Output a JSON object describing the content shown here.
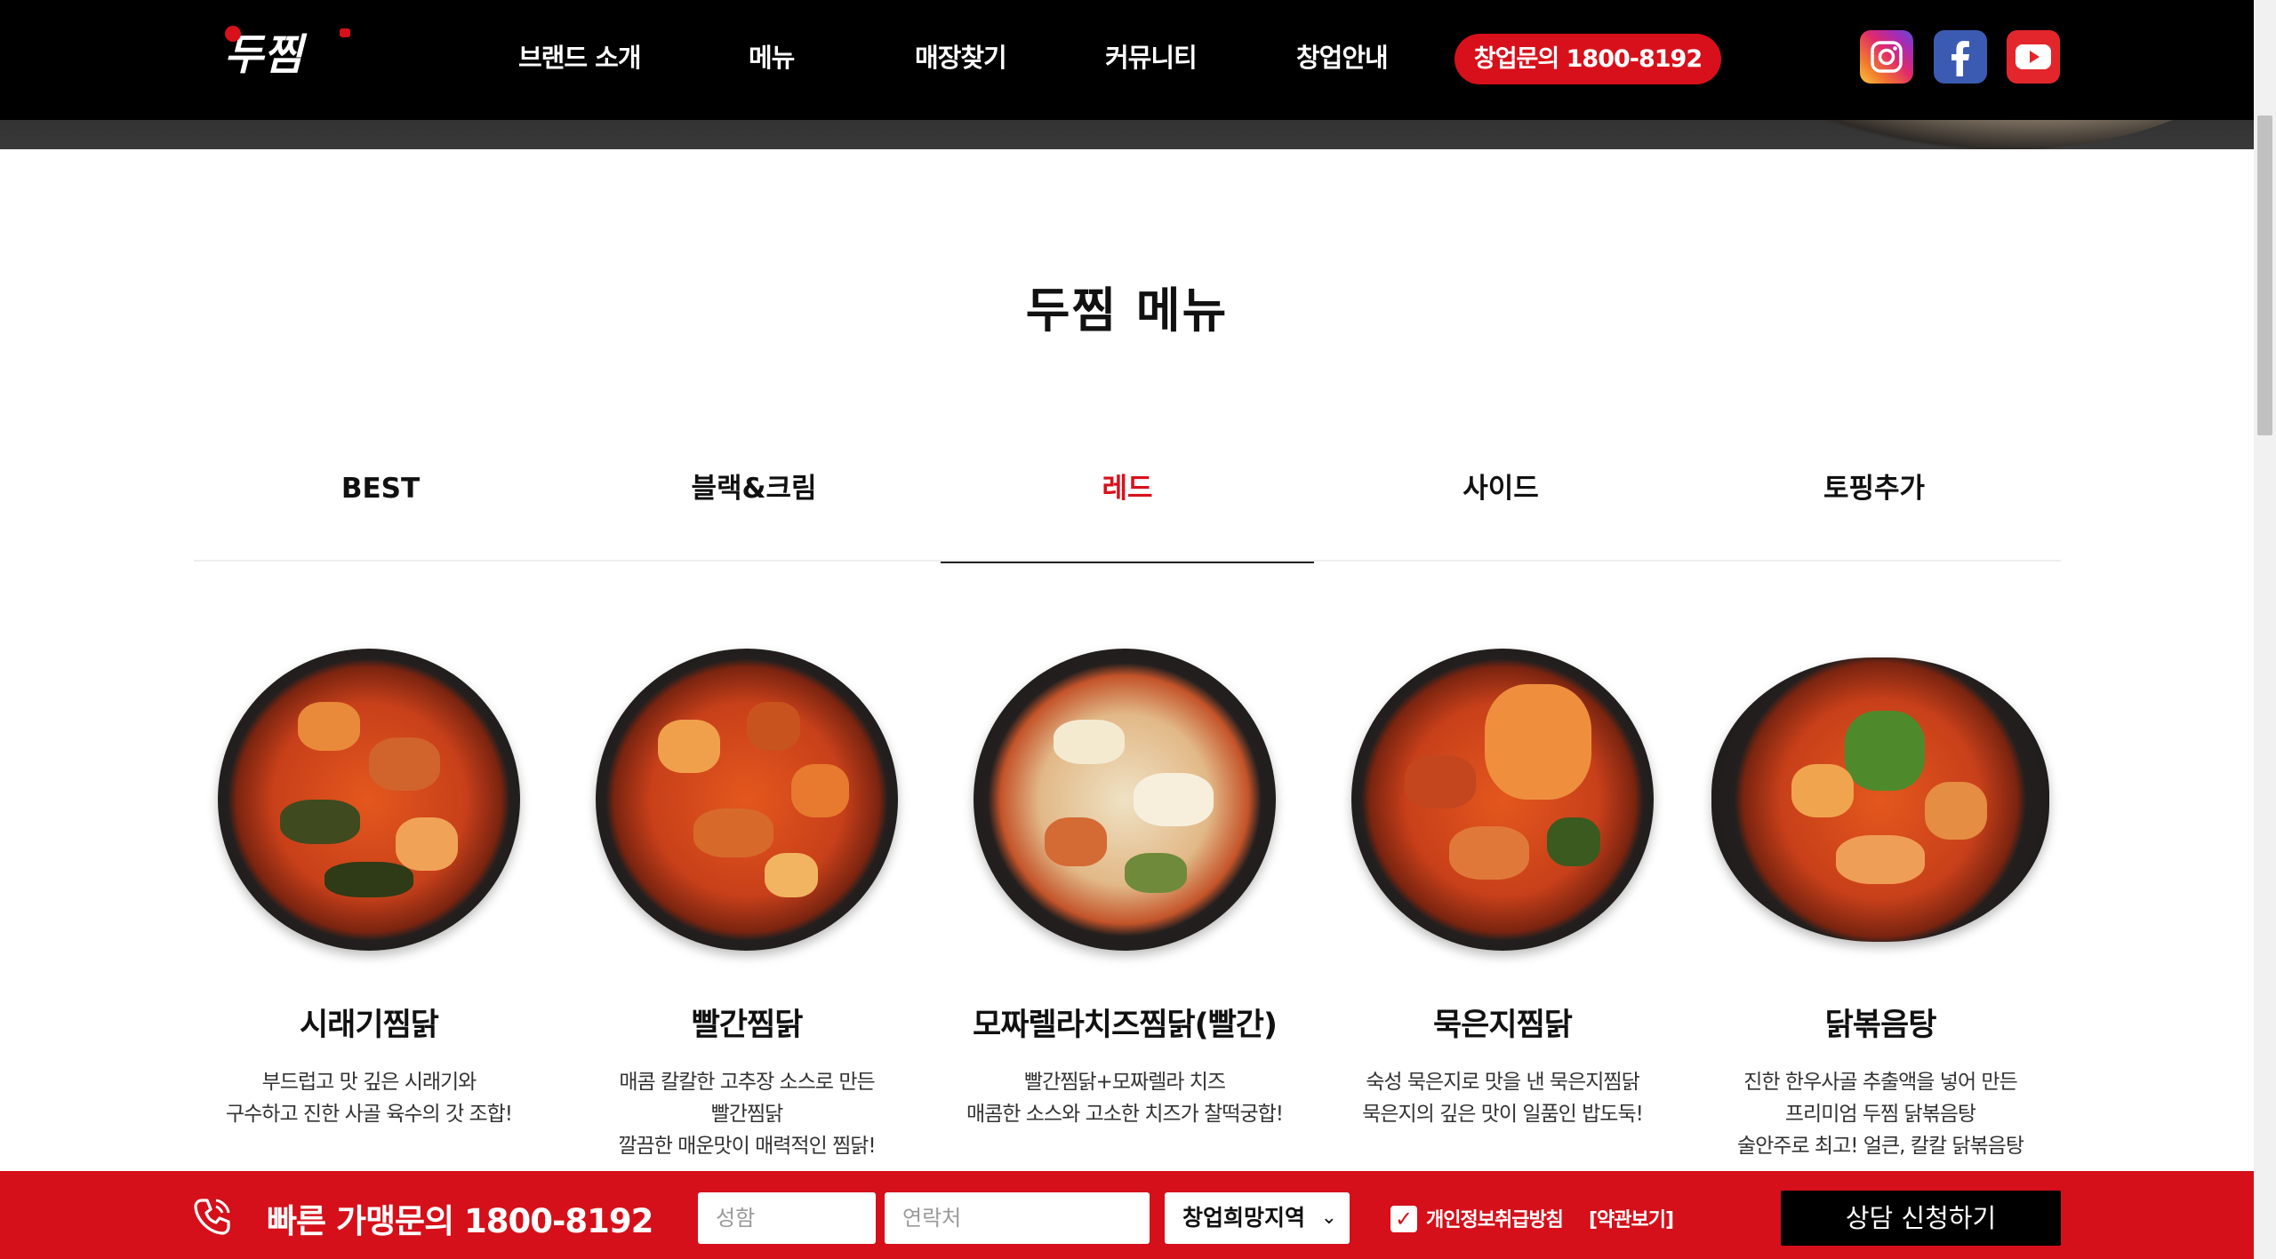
{
  "header": {
    "logo_text": "두찜",
    "nav": [
      "브랜드 소개",
      "메뉴",
      "매장찾기",
      "커뮤니티",
      "창업안내"
    ],
    "cta_label": "창업문의 1800-8192",
    "social": [
      "instagram-icon",
      "facebook-icon",
      "youtube-icon"
    ]
  },
  "section": {
    "title": "두찜 메뉴"
  },
  "tabs": {
    "items": [
      "BEST",
      "블랙&크림",
      "레드",
      "사이드",
      "토핑추가"
    ],
    "active": "레드"
  },
  "menu": [
    {
      "name": "시래기찜닭",
      "desc": [
        "부드럽고 맛 깊은 시래기와",
        "구수하고 진한 사골 육수의 갓 조합!"
      ]
    },
    {
      "name": "빨간찜닭",
      "desc": [
        "매콤 칼칼한 고추장 소스로 만든",
        "빨간찜닭",
        "깔끔한 매운맛이 매력적인 찜닭!"
      ]
    },
    {
      "name": "모짜렐라치즈찜닭(빨간)",
      "desc": [
        "빨간찜닭+모짜렐라 치즈",
        "매콤한 소스와 고소한 치즈가 찰떡궁합!"
      ]
    },
    {
      "name": "묵은지찜닭",
      "desc": [
        "숙성 묵은지로 맛을 낸 묵은지찜닭",
        "묵은지의 깊은 맛이 일품인 밥도둑!"
      ]
    },
    {
      "name": "닭볶음탕",
      "desc": [
        "진한 한우사골 추출액을 넣어 만든",
        "프리미엄 두찜 닭볶음탕",
        "술안주로 최고! 얼큰, 칼칼 닭볶음탕"
      ]
    }
  ],
  "bottom_bar": {
    "label": "빠른 가맹문의 1800-8192",
    "name_placeholder": "성함",
    "phone_placeholder": "연락처",
    "region_select": "창업희망지역",
    "privacy_label": "개인정보취급방침",
    "terms_label": "[약관보기]",
    "privacy_checked": true,
    "submit_label": "상담 신청하기"
  },
  "colors": {
    "brand_red": "#d8101b",
    "header_black": "#000000"
  }
}
